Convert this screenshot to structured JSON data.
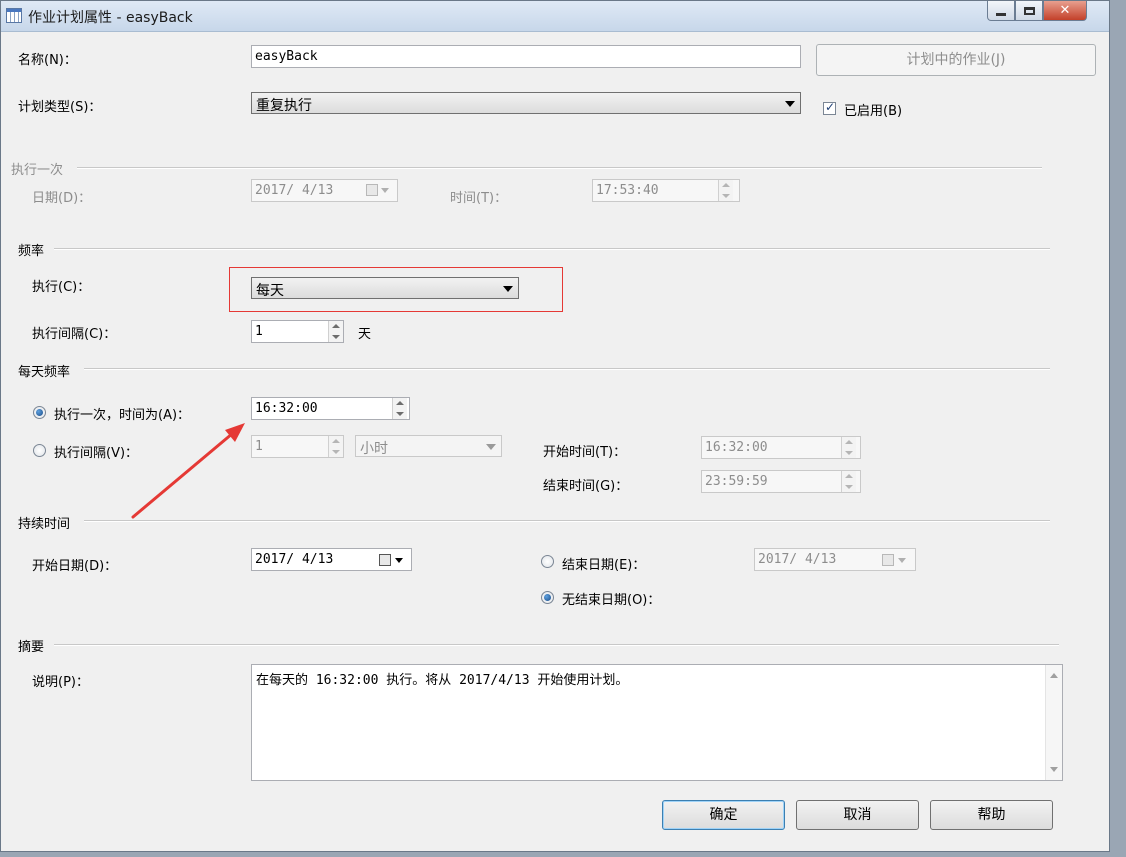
{
  "window": {
    "title": "作业计划属性 - easyBack",
    "controls": {
      "minimize": "minimize",
      "maximize": "maximize",
      "close": "✕"
    }
  },
  "general": {
    "name_label": "名称(N)：",
    "name_value": "easyBack",
    "jobs_in_schedule_button": "计划中的作业(J)",
    "schedule_type_label": "计划类型(S)：",
    "schedule_type_value": "重复执行",
    "enabled_label": "已启用(B)",
    "enabled_checked": true
  },
  "one_time": {
    "section": "执行一次",
    "date_label": "日期(D)：",
    "date_value": "2017/ 4/13",
    "time_label": "时间(T)：",
    "time_value": "17:53:40"
  },
  "frequency": {
    "section": "频率",
    "occurs_label": "执行(C)：",
    "occurs_value": "每天",
    "recurs_label": "执行间隔(C)：",
    "recurs_value": "1",
    "recurs_unit": "天"
  },
  "daily_frequency": {
    "section": "每天频率",
    "once_label": "执行一次，时间为(A)：",
    "once_selected": true,
    "once_time": "16:32:00",
    "every_label": "执行间隔(V)：",
    "every_value": "1",
    "every_unit": "小时",
    "start_time_label": "开始时间(T)：",
    "start_time": "16:32:00",
    "end_time_label": "结束时间(G)：",
    "end_time": "23:59:59"
  },
  "duration": {
    "section": "持续时间",
    "start_date_label": "开始日期(D)：",
    "start_date": "2017/ 4/13",
    "end_date_label": "结束日期(E)：",
    "end_date": "2017/ 4/13",
    "no_end_label": "无结束日期(O)：",
    "no_end_selected": true
  },
  "summary": {
    "section": "摘要",
    "description_label": "说明(P)：",
    "description": "在每天的 16:32:00 执行。将从 2017/4/13 开始使用计划。"
  },
  "buttons": {
    "ok": "确定",
    "cancel": "取消",
    "help": "帮助"
  },
  "annotation_color": "#e53935"
}
